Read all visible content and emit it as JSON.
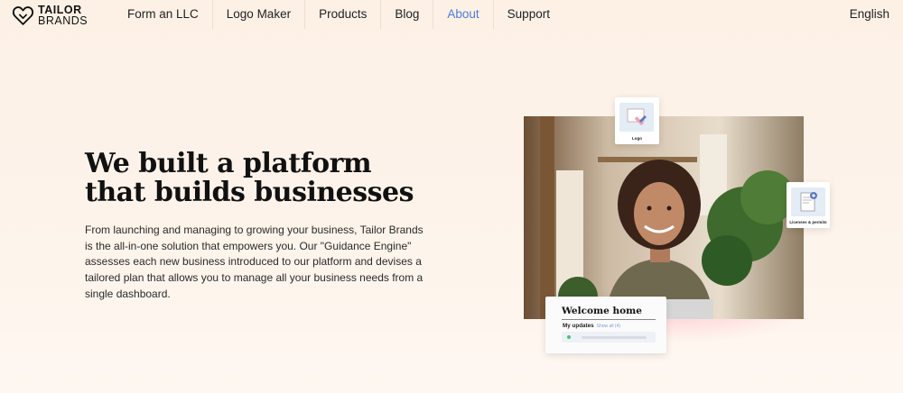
{
  "brand": {
    "line1": "TAILOR",
    "line2": "BRANDS",
    "icon": "heart-shield-logo-icon"
  },
  "nav": {
    "items": [
      {
        "label": "Form an LLC",
        "active": false
      },
      {
        "label": "Logo Maker",
        "active": false
      },
      {
        "label": "Products",
        "active": false
      },
      {
        "label": "Blog",
        "active": false
      },
      {
        "label": "About",
        "active": true
      },
      {
        "label": "Support",
        "active": false
      }
    ],
    "language": "English"
  },
  "hero": {
    "headline_line1": "We built a platform",
    "headline_line2": "that builds businesses",
    "description": "From launching and managing to growing your business, Tailor Brands is the all-in-one solution that empowers you. Our \"Guidance Engine\" assesses each new business introduced to our platform and devises a tailored plan that allows you to manage all your business needs from a single dashboard."
  },
  "cards": {
    "logo_caption": "Logo",
    "licenses_caption": "Licenses & permits",
    "welcome_title": "Welcome home",
    "updates_label": "My updates",
    "updates_link": "Show all (4)"
  },
  "colors": {
    "accent": "#4c7bd9",
    "background": "#fdf1e6",
    "status_green": "#45c37a"
  }
}
